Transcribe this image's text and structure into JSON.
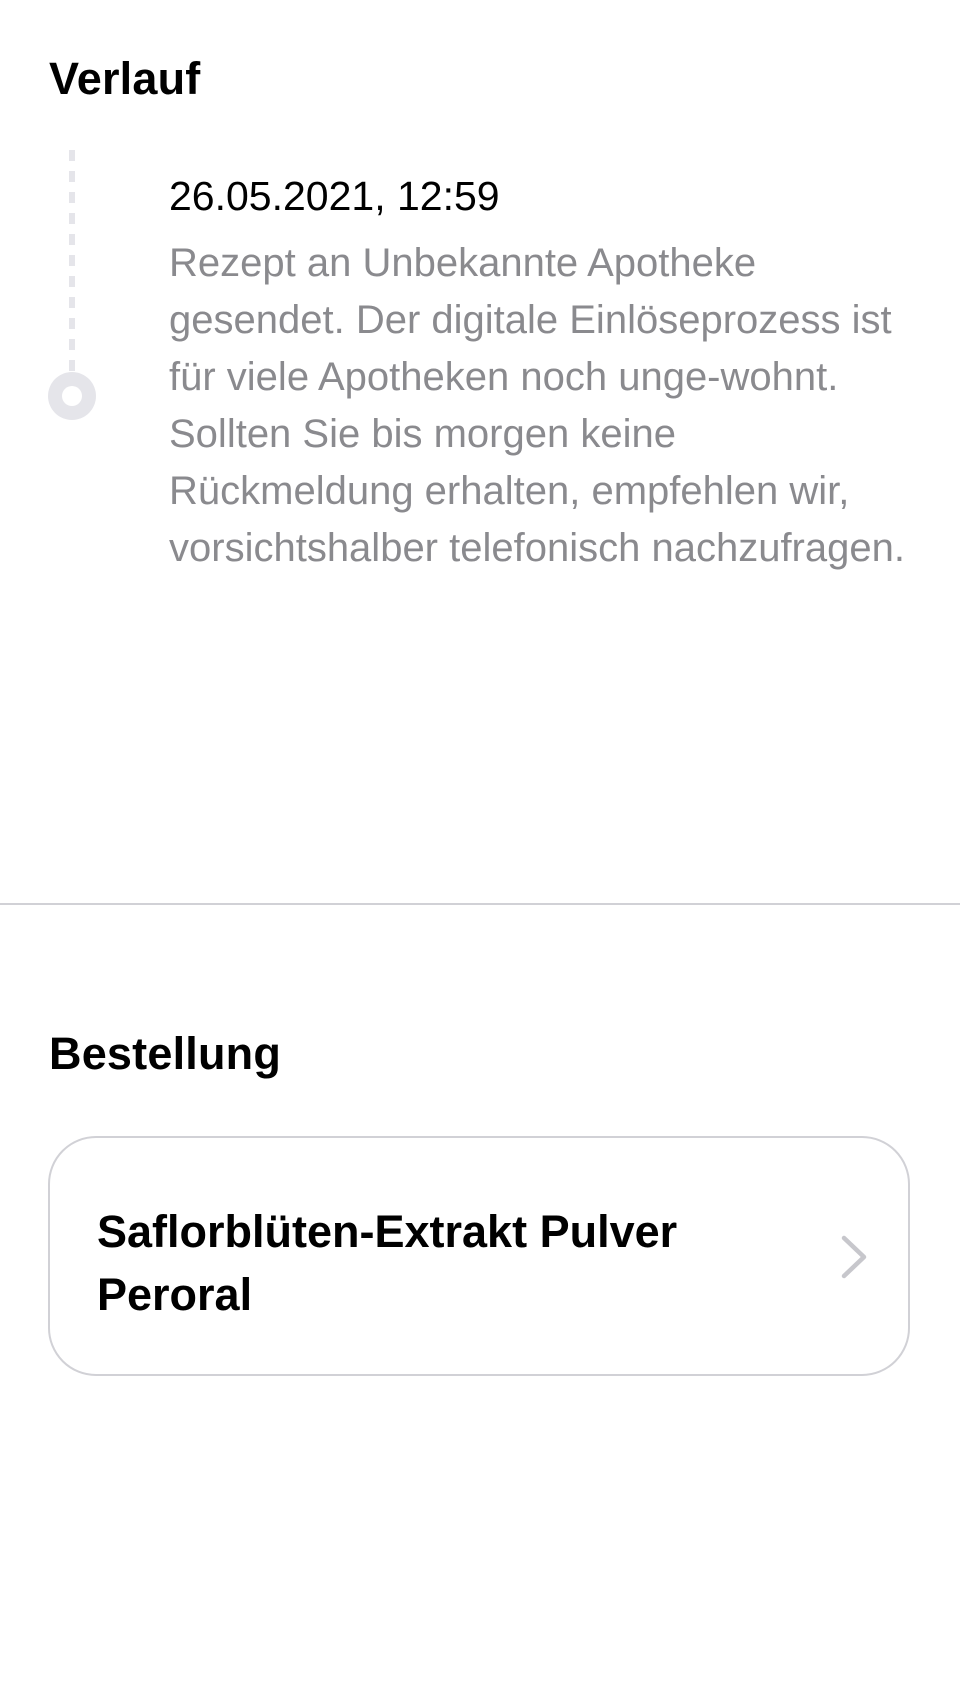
{
  "history": {
    "title": "Verlauf",
    "events": [
      {
        "date": "26.05.2021, 12:59",
        "text": "Rezept an Unbekannte Apotheke gesendet. Der digitale Einlöseprozess ist für viele Apotheken noch unge-wohnt. Sollten Sie bis morgen keine Rückmeldung erhalten, empfehlen wir, vorsichtshalber telefonisch nachzufragen."
      }
    ]
  },
  "order": {
    "title": "Bestellung",
    "items": [
      {
        "name": "Saflorblüten-Extrakt Pulver Peroral",
        "icon": "chevron-right-icon"
      }
    ]
  },
  "colors": {
    "text_primary": "#000000",
    "text_secondary": "#8a8a8e",
    "timeline": "#e5e5ea",
    "border": "#d1d1d6",
    "chevron": "#c7c7cc"
  }
}
